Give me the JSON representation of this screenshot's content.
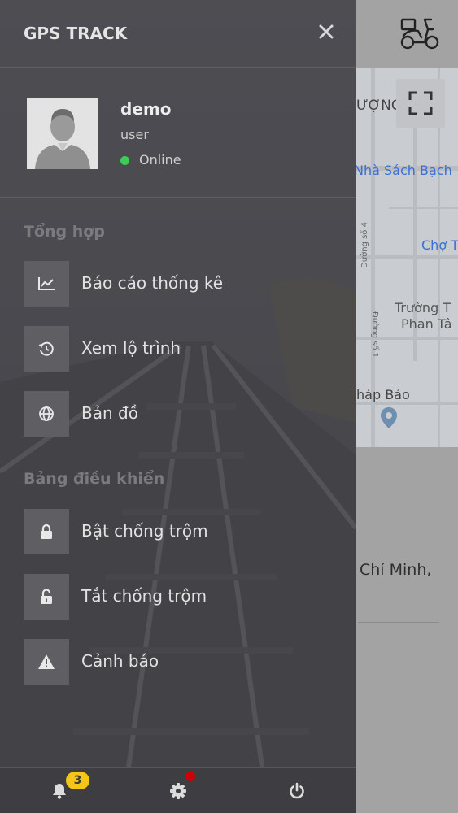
{
  "app": {
    "title": "GPS TRACK"
  },
  "profile": {
    "name": "demo",
    "role": "user",
    "status": "Online",
    "status_color": "#3ecc55"
  },
  "sections": {
    "summary_title": "Tổng hợp",
    "control_title": "Bảng điều khiển"
  },
  "menu": {
    "items": [
      {
        "label": "Báo cáo thống kê",
        "icon": "chart-icon"
      },
      {
        "label": "Xem lộ trình",
        "icon": "history-icon"
      },
      {
        "label": "Bản đồ",
        "icon": "globe-icon"
      },
      {
        "label": "Bật chống trộm",
        "icon": "lock-icon"
      },
      {
        "label": "Tắt chống trộm",
        "icon": "unlock-icon"
      },
      {
        "label": "Cảnh báo",
        "icon": "warning-icon"
      }
    ]
  },
  "bottom_bar": {
    "notification_count": "3",
    "icons": [
      "bell-icon",
      "gear-icon",
      "power-icon"
    ],
    "badge_color": "#f5c518",
    "settings_dot_color": "#d00000"
  },
  "map": {
    "labels": [
      "ƯỢNG",
      "Nhà Sách Bạch",
      "Chợ T",
      "Trường T",
      "Phan Tâ",
      "Đường số 4",
      "Đường số 1",
      "háp Bảo"
    ],
    "address": "Chí Minh,"
  },
  "colors": {
    "drawer_bg": "#4a4a4f",
    "map_label_blue": "#3b6fd4"
  }
}
